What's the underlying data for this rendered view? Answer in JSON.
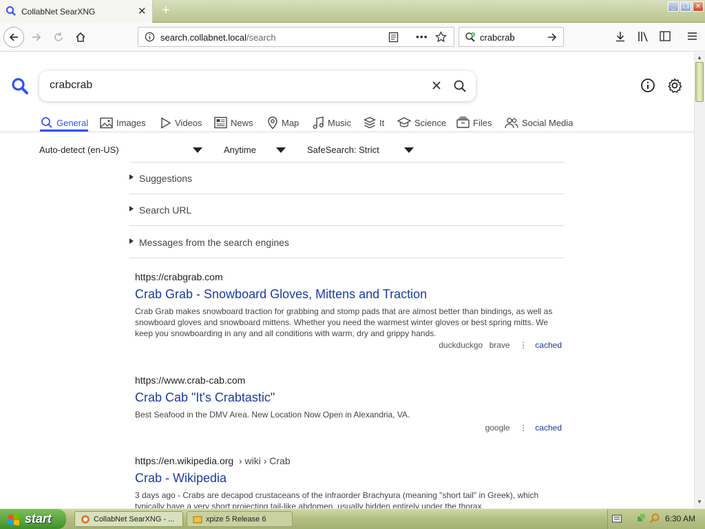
{
  "browser": {
    "tab_title": "CollabNet SearXNG",
    "url_host": "search.collabnet.local",
    "url_path": "/search",
    "searchbar_value": "crabcrab"
  },
  "search": {
    "query": "crabcrab",
    "categories": [
      {
        "label": "General",
        "icon": "search-icon",
        "active": true
      },
      {
        "label": "Images",
        "icon": "image-icon"
      },
      {
        "label": "Videos",
        "icon": "play-icon"
      },
      {
        "label": "News",
        "icon": "newspaper-icon"
      },
      {
        "label": "Map",
        "icon": "map-pin-icon"
      },
      {
        "label": "Music",
        "icon": "music-icon"
      },
      {
        "label": "It",
        "icon": "layers-icon"
      },
      {
        "label": "Science",
        "icon": "graduation-cap-icon"
      },
      {
        "label": "Files",
        "icon": "files-icon"
      },
      {
        "label": "Social Media",
        "icon": "people-icon"
      }
    ],
    "filters": {
      "language": "Auto-detect (en-US)",
      "time": "Anytime",
      "safesearch": "SafeSearch: Strict"
    },
    "accordions": [
      "Suggestions",
      "Search URL",
      "Messages from the search engines"
    ],
    "results": [
      {
        "url": "https://crabgrab.com",
        "crumbs": "",
        "title": "Crab Grab - Snowboard Gloves, Mittens and Traction",
        "description": "Crab Grab makes snowboard traction for grabbing and stomp pads that are almost better than bindings, as well as snowboard gloves and snowboard mittens. Whether you need the warmest winter gloves or best spring mitts. We keep you snowboarding in any and all conditions with warm, dry and grippy hands.",
        "engines": [
          "duckduckgo",
          "brave"
        ],
        "cached_label": "cached"
      },
      {
        "url": "https://www.crab-cab.com",
        "crumbs": "",
        "title": "Crab Cab \"It's Crabtastic\"",
        "description": "Best Seafood in the DMV Area. New Location Now Open in Alexandria, VA.",
        "engines": [
          "google"
        ],
        "cached_label": "cached"
      },
      {
        "url": "https://en.wikipedia.org",
        "crumbs": "› wiki › Crab",
        "title": "Crab - Wikipedia",
        "description": "3 days ago - Crabs are decapod crustaceans of the infraorder Brachyura (meaning \"short tail\" in Greek), which typically have a very short projecting tail-like abdomen, usually hidden entirely under the thorax.",
        "engines": [],
        "cached_label": ""
      }
    ]
  },
  "taskbar": {
    "start_label": "start",
    "items": [
      "CollabNet SearXNG - ...",
      "xpize 5 Release 6"
    ],
    "clock": "6:30 AM"
  },
  "colors": {
    "accent": "#3050ff",
    "link": "#1a3ca6",
    "taskbar": "#b4bf84"
  }
}
